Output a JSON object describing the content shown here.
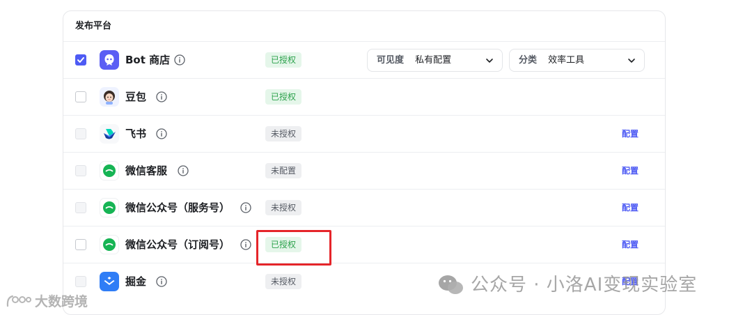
{
  "panel": {
    "title": "发布平台"
  },
  "rows": [
    {
      "name": "Bot 商店",
      "status": "已授权",
      "status_type": "ok",
      "checked": true,
      "disabled": false,
      "logo": "bot-store-icon",
      "visibility": {
        "label": "可见度",
        "value": "私有配置"
      },
      "category": {
        "label": "分类",
        "value": "效率工具"
      }
    },
    {
      "name": "豆包",
      "status": "已授权",
      "status_type": "ok",
      "checked": false,
      "disabled": false,
      "logo": "doubao-icon"
    },
    {
      "name": "飞书",
      "status": "未授权",
      "status_type": "no",
      "checked": false,
      "disabled": true,
      "logo": "feishu-icon",
      "action": "配置"
    },
    {
      "name": "微信客服",
      "status": "未配置",
      "status_type": "no",
      "checked": false,
      "disabled": true,
      "logo": "wechat-icon",
      "action": "配置"
    },
    {
      "name": "微信公众号（服务号）",
      "status": "未授权",
      "status_type": "no",
      "checked": false,
      "disabled": true,
      "logo": "wechat-icon",
      "action": "配置"
    },
    {
      "name": "微信公众号（订阅号）",
      "status": "已授权",
      "status_type": "ok",
      "checked": false,
      "disabled": false,
      "logo": "wechat-icon",
      "action": "配置"
    },
    {
      "name": "掘金",
      "status": "未授权",
      "status_type": "no",
      "checked": false,
      "disabled": true,
      "logo": "juejin-icon",
      "action": "配置"
    }
  ],
  "watermarks": {
    "right": "公众号 · 小洛AI变现实验室",
    "left": "大数跨境"
  },
  "colors": {
    "accent": "#4e5bf4",
    "authorized_green": "#2ba14b",
    "highlight_red": "#e5252a"
  }
}
